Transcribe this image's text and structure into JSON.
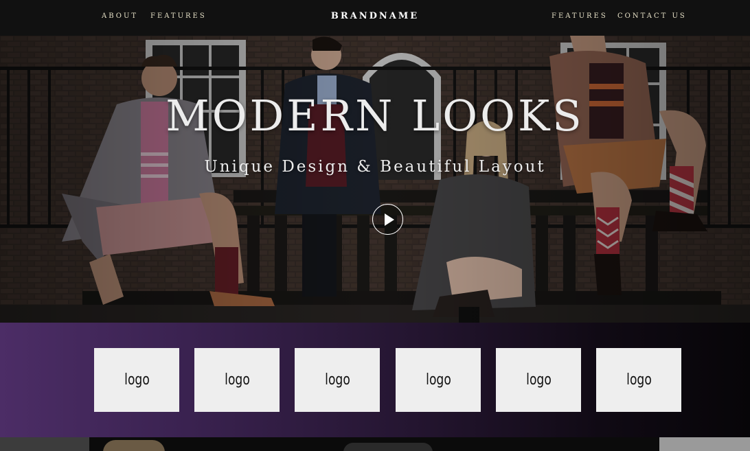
{
  "nav": {
    "left_links": [
      "ABOUT",
      "FEATURES"
    ],
    "brand": "BRANDNAME",
    "right_links": [
      "FEATURES",
      "CONTACT US"
    ]
  },
  "hero": {
    "title": "MODERN LOOKS",
    "subtitle": "Unique Design & Beautiful Layout",
    "play_icon": "play-icon"
  },
  "logos": [
    "logo",
    "logo",
    "logo",
    "logo",
    "logo",
    "logo"
  ],
  "colors": {
    "navbar_bg": "#111111",
    "nav_text": "#e8e2c8",
    "logo_strip_start": "#4c2d66",
    "logo_strip_end": "#070508",
    "logo_box_bg": "#eeeeee"
  }
}
